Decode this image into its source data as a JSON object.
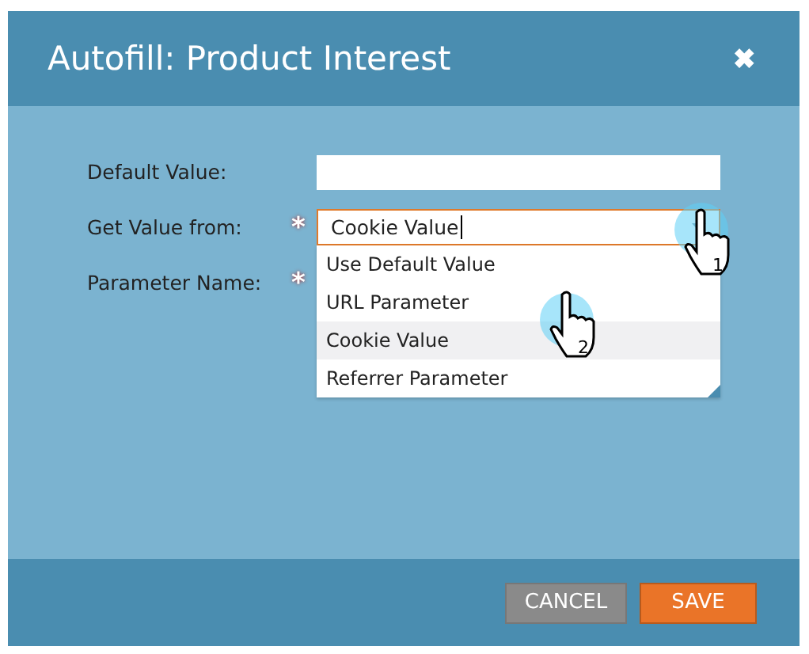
{
  "dialog": {
    "title": "Autofill: Product Interest",
    "close": "✖"
  },
  "fields": [
    {
      "kind": "text",
      "label": "Default Value:"
    },
    {
      "kind": "combo",
      "label": "Get Value from:",
      "required_mark": "*",
      "value": "Cookie Value",
      "focused": true,
      "expanded": true,
      "options": [
        {
          "label": "Use Default Value",
          "selected": false
        },
        {
          "label": "URL Parameter",
          "selected": false
        },
        {
          "label": "Cookie Value",
          "selected": true
        },
        {
          "label": "Referrer Parameter",
          "selected": false
        }
      ]
    },
    {
      "kind": "label",
      "label": "Parameter Name:",
      "required_mark": "*"
    }
  ],
  "cursors": [
    {
      "label": "1"
    },
    {
      "label": "2"
    }
  ],
  "buttons": [
    {
      "label": "CANCEL",
      "kind": "secondary"
    },
    {
      "label": "SAVE",
      "kind": "primary"
    }
  ]
}
